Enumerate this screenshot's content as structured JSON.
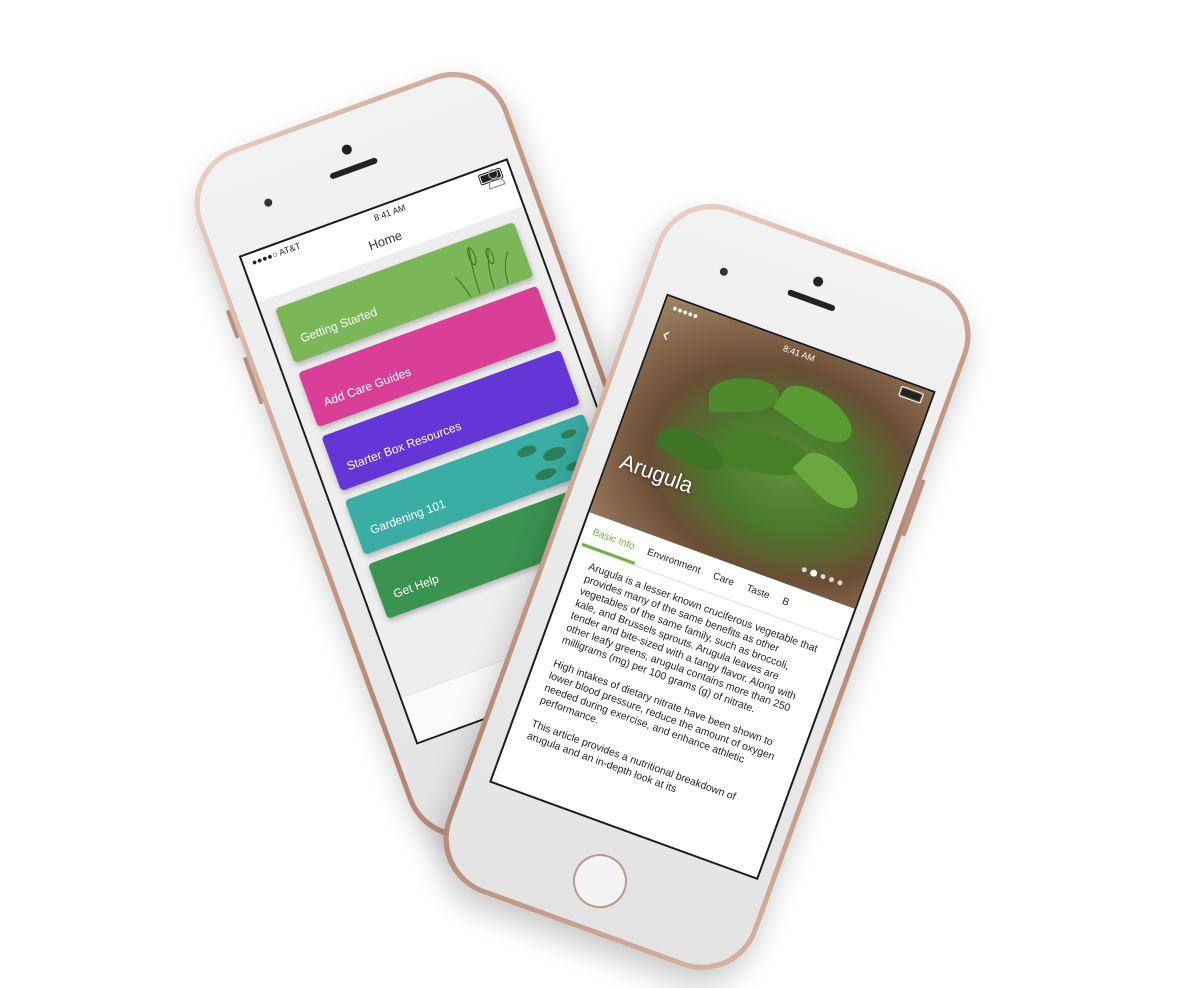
{
  "phone1": {
    "status": {
      "carrier": "AT&T",
      "time": "8:41 AM"
    },
    "header": {
      "title": "Home"
    },
    "cards": [
      {
        "label": "Getting Started",
        "color": "#7bb657"
      },
      {
        "label": "Add Care Guides",
        "color": "#d93f97"
      },
      {
        "label": "Starter Box Resources",
        "color": "#6536d6"
      },
      {
        "label": "Gardening 101",
        "color": "#3aaea4"
      },
      {
        "label": "Get Help",
        "color": "#3b9350"
      }
    ],
    "tabbar": {
      "icon": "home-icon"
    },
    "accent": "#6cb33f"
  },
  "phone2": {
    "status": {
      "time": "8:41 AM"
    },
    "hero": {
      "title": "Arugula"
    },
    "tabs": [
      "Basic Info",
      "Environment",
      "Care",
      "Taste",
      "B"
    ],
    "article": [
      "Arugula is a lesser known cruciferous vegetable that provides many of the same benefits as other vegetables of the same family, such as broccoli, kale, and Brussels sprouts. Arugula leaves are tender and bite-sized with a tangy flavor. Along with other leafy greens, arugula contains more than 250 milligrams (mg) per 100 grams (g) of nitrate.",
      "High intakes of dietary nitrate have been shown to lower blood pressure, reduce the amount of oxygen needed during exercise, and enhance athletic performance.",
      "This article provides a nutritional breakdown of arugula and an in-depth look at its"
    ]
  }
}
